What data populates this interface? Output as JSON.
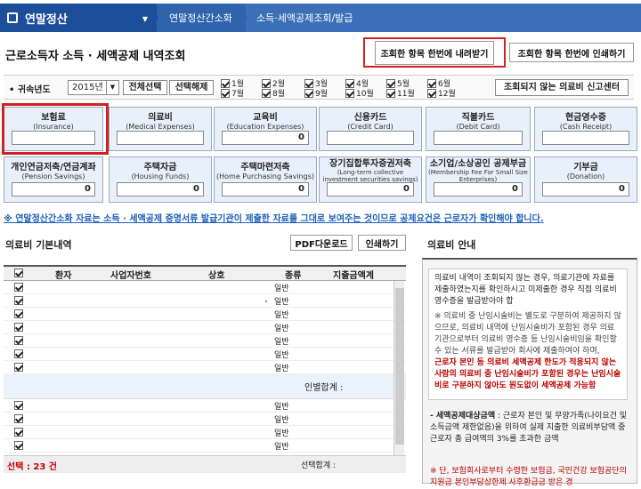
{
  "nav": {
    "main": "연말정산",
    "crumb1": "연말정산간소화",
    "crumb2": "소득·세액공제조회/발급"
  },
  "page": {
    "title": "근로소득자 소득 · 세액공제 내역조회"
  },
  "actions": {
    "download": "조회한 항목 한번에 내려받기",
    "print_all": "조회한 항목 한번에 인쇄하기"
  },
  "filter": {
    "year_label": "귀속년도",
    "year_value": "2015년",
    "select_all": "전체선택",
    "deselect": "선택해제",
    "months": [
      "1월",
      "2월",
      "3월",
      "4월",
      "5월",
      "6월",
      "7월",
      "8월",
      "9월",
      "10월",
      "11월",
      "12월"
    ],
    "report_center": "조회되지 않는 의료비 신고센터"
  },
  "categories": [
    {
      "name": "보험료",
      "en": "(Insurance)",
      "value": ""
    },
    {
      "name": "의료비",
      "en": "(Medical Expenses)",
      "value": ""
    },
    {
      "name": "교육비",
      "en": "(Education Expenses)",
      "value": "0"
    },
    {
      "name": "신용카드",
      "en": "(Credit Card)",
      "value": ""
    },
    {
      "name": "직불카드",
      "en": "(Debit Card)",
      "value": ""
    },
    {
      "name": "현금영수증",
      "en": "(Cash Receipt)",
      "value": ""
    },
    {
      "name": "개인연금저축/연금계좌",
      "en": "(Pension Savings)",
      "value": "0"
    },
    {
      "name": "주택자금",
      "en": "(Housing Funds)",
      "value": "0"
    },
    {
      "name": "주택마련저축",
      "en": "(Home Purchasing Savings)",
      "value": "0"
    },
    {
      "name": "장기집합투자증권저축",
      "en": "(Long-term collective investment securities savings)",
      "value": "0"
    },
    {
      "name": "소기업/소상공인 공제부금",
      "en": "(Membership Fee For Small Size Enterprises)",
      "value": "0"
    },
    {
      "name": "기부금",
      "en": "(Donation)",
      "value": "0"
    }
  ],
  "notice": "※ 연말정산간소화 자료는 소득 · 세액공제 증명서류 발급기관이 제출한 자료를 그대로 보여주는 것이므로 공제요건은 근로자가 확인해야 합니다.",
  "medical": {
    "title": "의료비 기본내역",
    "pdf": "PDF다운로드",
    "print": "인쇄하기",
    "headers": [
      "환자",
      "사업자번호",
      "상호",
      "종류",
      "지출금액계"
    ],
    "kind": "일반",
    "subtotal_label": "인별합계 :",
    "selected_count": "선택 : 23 건",
    "selected_total": "선택합계 :"
  },
  "guide": {
    "title": "의료비 안내",
    "p1": "의료비 내역이 조회되지 않는 경우, 의료기관에 자료를 제출하였는지를 확인하시고 미제출한 경우 직접 의료비 영수증을 발급받아야 합",
    "p2": "※ 의료비 중 난임시술비는 별도로 구분하여 제공하지 않으므로, 의료비 내역에 난임시술비가 포함된 경우 의료기관으로부터 의료비 영수증 등 난임시술비임을 확인할 수 있는 서류를 발급받아 회사에 제출하여야 하며,",
    "p2_red": "근로자 본인 등 의료비 세액공제 한도가 적용되지 않는 사람의 의료비 중 난임시술비가 포함된 경우는 난임시술비로 구분하지 않아도 원도없이 세액공제 가능함",
    "p3_label": "- 세액공제대상금액",
    "p3": ": 근로자 본인 및 무양가족(나이요건 및 소득금액 제한없음)을 위하여 실제 지출한 의료비부담액 중 근로자 총 급여액의 3%를 초과한 금액",
    "p4": "※ 단, 보험회사로부터 수령한 보험금, 국민건강 보험공단의 지원금 본인부담상한제 사후환급금 받은 경"
  }
}
